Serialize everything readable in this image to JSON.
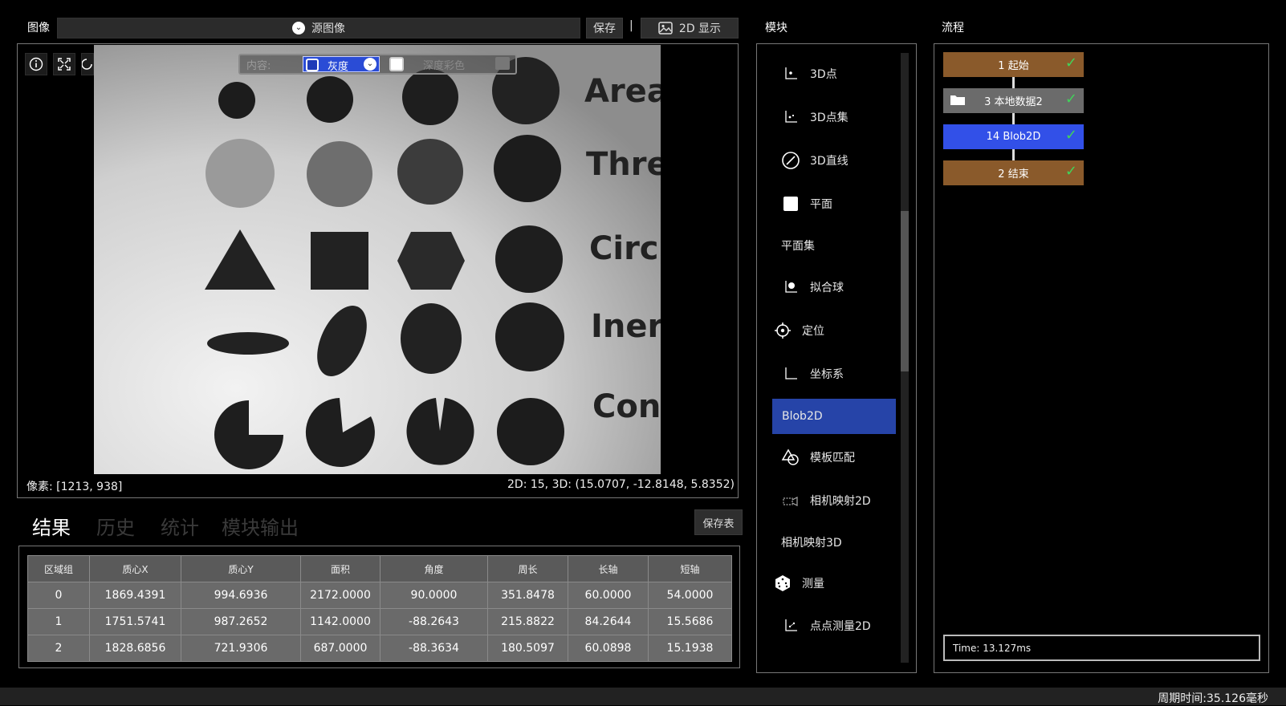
{
  "image_section": {
    "title": "图像",
    "source_select": "源图像",
    "save_label": "保存",
    "separator": "|",
    "display_mode_label": "2D 显示",
    "overlay": {
      "content_label": "内容:",
      "gray_label": "灰度",
      "depth_label": "深度彩色"
    },
    "image_text": [
      "Area",
      "Thre",
      "Circ",
      "Iner",
      "Con"
    ],
    "pixel_readout": "像素: [1213, 938]",
    "coord_readout": "2D: 15, 3D: (15.0707, -12.8148, 5.8352)"
  },
  "result_tabs": [
    {
      "label": "结果",
      "active": true
    },
    {
      "label": "历史",
      "active": false
    },
    {
      "label": "统计",
      "active": false
    },
    {
      "label": "模块输出",
      "active": false
    }
  ],
  "save_table_label": "保存表",
  "results_table": {
    "headers": [
      "区域组",
      "质心X",
      "质心Y",
      "面积",
      "角度",
      "周长",
      "长轴",
      "短轴"
    ],
    "rows": [
      [
        "0",
        "1869.4391",
        "994.6936",
        "2172.0000",
        "90.0000",
        "351.8478",
        "60.0000",
        "54.0000"
      ],
      [
        "1",
        "1751.5741",
        "987.2652",
        "1142.0000",
        "-88.2643",
        "215.8822",
        "84.2644",
        "15.5686"
      ],
      [
        "2",
        "1828.6856",
        "721.9306",
        "687.0000",
        "-88.3634",
        "180.5097",
        "60.0898",
        "15.1938"
      ]
    ]
  },
  "module_section": {
    "title": "模块",
    "items": [
      {
        "label": "3D点",
        "icon": "axis-point-icon"
      },
      {
        "label": "3D点集",
        "icon": "axis-point-set-icon"
      },
      {
        "label": "3D直线",
        "icon": "circle-slash-icon"
      },
      {
        "label": "平面",
        "icon": "square-icon"
      },
      {
        "label": "平面集",
        "icon": ""
      },
      {
        "label": "拟合球",
        "icon": "fit-sphere-icon"
      },
      {
        "label": "定位",
        "icon": "crosshair-icon"
      },
      {
        "label": "坐标系",
        "icon": "coordinate-icon"
      },
      {
        "label": "Blob2D",
        "icon": "",
        "selected": true
      },
      {
        "label": "模板匹配",
        "icon": "template-match-icon"
      },
      {
        "label": "相机映射2D",
        "icon": "camera-map-icon"
      },
      {
        "label": "相机映射3D",
        "icon": ""
      },
      {
        "label": "测量",
        "icon": "dice-icon"
      },
      {
        "label": "点点测量2D",
        "icon": "point-measure-icon"
      }
    ]
  },
  "flow_section": {
    "title": "流程",
    "nodes": [
      {
        "label": "1 起始",
        "color": "#8a5a2b"
      },
      {
        "label": "3 本地数据2",
        "color": "#6b6b6b"
      },
      {
        "label": "14 Blob2D",
        "color": "#3250e8"
      },
      {
        "label": "2 结束",
        "color": "#8a5a2b"
      }
    ],
    "time_label": "Time: 13.127ms"
  },
  "status_bar": {
    "cycle_time": "周期时间:35.126毫秒"
  },
  "colors": {
    "selected_module": "#2644a8",
    "check_green": "#41d35a"
  }
}
